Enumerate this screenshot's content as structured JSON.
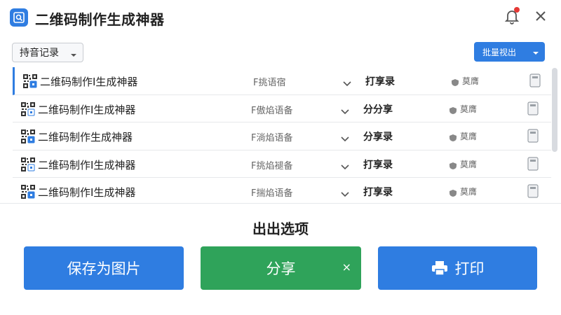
{
  "app": {
    "title": "二维码制作生成神器"
  },
  "toolbar": {
    "history_label": "持音记录",
    "batch_label": "批量视出"
  },
  "rows": [
    {
      "name": "二维码制作I生成神器",
      "type": "F挑语宿",
      "action": "打享录",
      "badge": "莫膺"
    },
    {
      "name": "二维码制作I生成神器",
      "type": "F傲焰语备",
      "action": "分分享",
      "badge": "莫膺"
    },
    {
      "name": "二维码制作生成神器",
      "type": "F淌焰语备",
      "action": "分享录",
      "badge": "莫膺"
    },
    {
      "name": "二维码制作I生成神器",
      "type": "F挑焰褪备",
      "action": "打享录",
      "badge": "莫膺"
    },
    {
      "name": "二维码制作I生成神器",
      "type": "F揣焰语备",
      "action": "打享录",
      "badge": "莫膺"
    }
  ],
  "options": {
    "title": "出出选项",
    "save_label": "保存为图片",
    "share_label": "分享",
    "share_close": "×",
    "print_label": "打印"
  },
  "colors": {
    "accent": "#2f7de1",
    "share_green": "#2fa35a",
    "notify_red": "#e53935"
  }
}
